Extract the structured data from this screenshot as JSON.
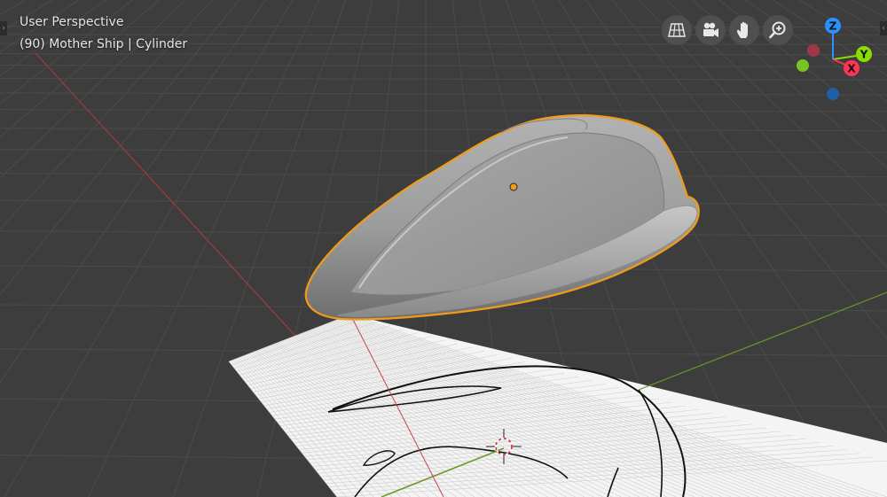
{
  "viewport": {
    "title": "User Perspective",
    "object_info": "(90) Mother Ship | Cylinder"
  },
  "nav_buttons": [
    {
      "name": "toggle-orthographic-button",
      "icon": "grid-icon"
    },
    {
      "name": "toggle-camera-view-button",
      "icon": "camera-icon"
    },
    {
      "name": "pan-view-button",
      "icon": "hand-icon"
    },
    {
      "name": "zoom-view-button",
      "icon": "magnifier-plus-icon"
    }
  ],
  "gizmo": {
    "z_label": "Z",
    "y_label": "Y",
    "x_label": "X",
    "colors": {
      "x": "#ff3352",
      "y": "#8bdc00",
      "z": "#2890ff"
    }
  },
  "colors": {
    "background": "#3d3d3d",
    "grid": "#4a4a4a",
    "selection_outline": "#f09c1a",
    "origin_point": "#f09c1a",
    "x_axis_line": "#a33a3a",
    "y_axis_line": "#6a9a2a"
  }
}
